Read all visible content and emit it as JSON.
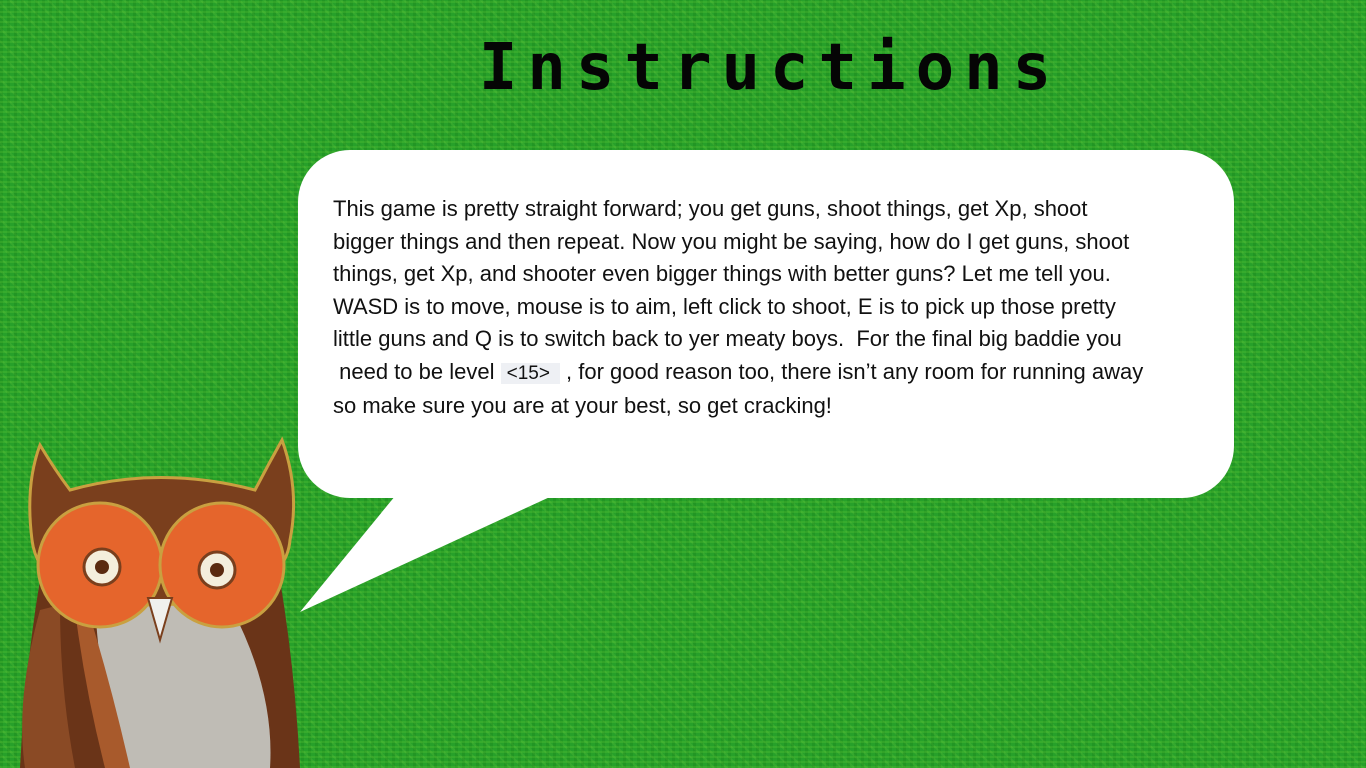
{
  "screen": {
    "title": "Instructions"
  },
  "dialog": {
    "text_part1": "This game is pretty straight forward; you get guns, shoot things, get Xp, shoot\nbigger things and then repeat. Now you might be saying, how do I get guns, shoot\nthings, get Xp, and shooter even bigger things with better guns? Let me tell you.\nWASD is to move, mouse is to aim, left click to shoot, E is to pick up those pretty\nlittle guns and Q is to switch back to yer meaty boys.  For the final big baddie you\n need to be level ",
    "level_value": "<15>",
    "text_part2": " , for good reason too, there isn’t any room for running away\nso make sure you are at your best, so get cracking!"
  },
  "colors": {
    "background": "#27a02a",
    "bubble": "#ffffff",
    "title": "#050505",
    "owl_brown": "#7a3f1d",
    "owl_orange": "#e5652c"
  },
  "icons": {
    "character": "owl-icon"
  }
}
